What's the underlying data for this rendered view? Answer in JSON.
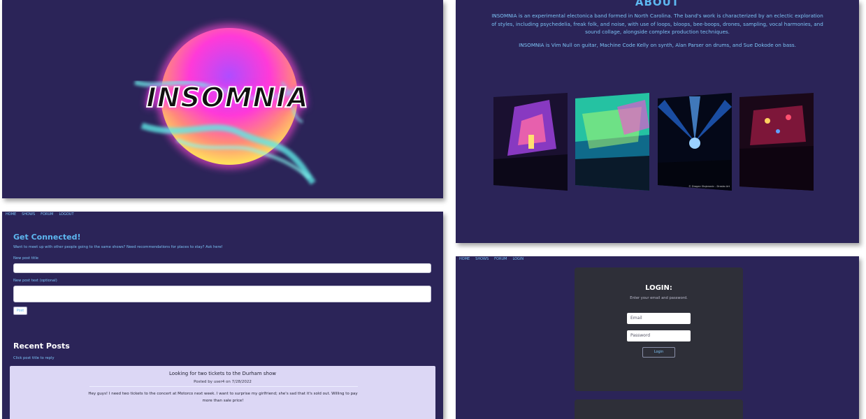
{
  "hero": {
    "logo_text": "INSOMNIA"
  },
  "about": {
    "title": "ABOUT",
    "paragraph1": "INSOMNIA is an experimental electonica band formed in North Carolina. The band's work is characterized by an eclectic exploration of styles, including psychedelia, freak folk, and noise, with use of loops, bloops, bee-boops, drones, sampling, vocal harmonies, and sound collage, alongside complex production techniques.",
    "paragraph2": "INSOMNIA is Vim Null on guitar, Machine Code Kelly on synth, Alan Parser on drums, and Sue Dokode on bass.",
    "photo_credit": "© Dragan Stojanovic - Drasko Art"
  },
  "forum": {
    "nav": [
      "HOME",
      "SHOWS",
      "FORUM",
      "LOGOUT"
    ],
    "heading": "Get Connected!",
    "subheading": "Want to meet up with other people going to the same shows? Need recommendations for places to stay? Ask here!",
    "title_label": "New post title",
    "text_label": "New post text (optional)",
    "post_button": "Post",
    "recent_heading": "Recent Posts",
    "recent_sub": "Click post title to reply",
    "posts": [
      {
        "title": "Looking for two tickets to the Durham show",
        "meta": "Posted by user4 on 7/28/2022",
        "body": "Hey guys! I need two tickets to the concert at Motorco next week. I want to surprise my girlfriend; she's sad that it's sold out. Willing to pay more than sale price!"
      }
    ]
  },
  "login": {
    "nav": [
      "HOME",
      "SHOWS",
      "FORUM",
      "LOGIN"
    ],
    "title": "LOGIN:",
    "subtitle": "Enter your email and password.",
    "email_placeholder": "Email",
    "password_placeholder": "Password",
    "button": "Login"
  },
  "colors": {
    "panel_bg": "#2b2458",
    "accent": "#5db7f0",
    "card_bg": "#2e2f38",
    "post_bg": "#dcd7f5"
  }
}
